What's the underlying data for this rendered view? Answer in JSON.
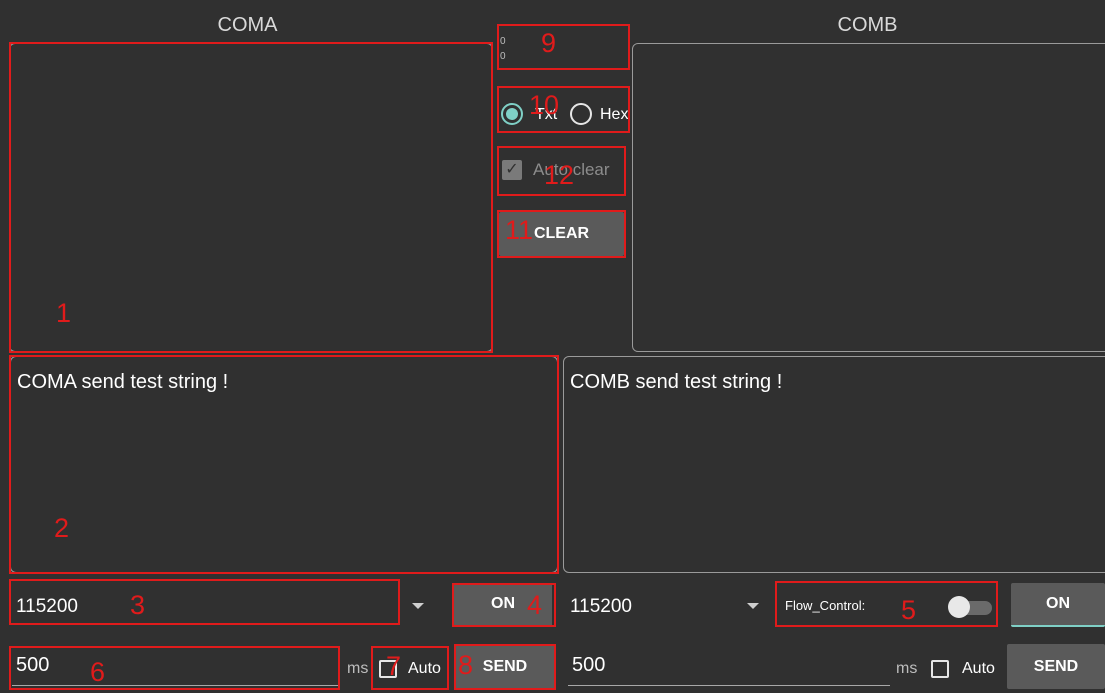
{
  "coma": {
    "title": "COMA",
    "send_text": "COMA send test string !",
    "baud": "115200",
    "on_label": "ON",
    "interval": "500",
    "ms_label": "ms",
    "auto_label": "Auto",
    "send_label": "SEND"
  },
  "comb": {
    "title": "COMB",
    "send_text": "COMB send test string !",
    "baud": "115200",
    "flow_control_label": "Flow_Control:",
    "on_label": "ON",
    "interval": "500",
    "ms_label": "ms",
    "auto_label": "Auto",
    "send_label": "SEND"
  },
  "middle": {
    "counter_rx": "0",
    "counter_tx": "0",
    "radio_txt": "Txt",
    "radio_hex": "Hex",
    "radio_selected": "Txt",
    "autoclear_label": "Auto clear",
    "autoclear_checked": true,
    "clear_label": "CLEAR"
  },
  "annotations": [
    "1",
    "2",
    "3",
    "4",
    "5",
    "6",
    "7",
    "8",
    "9",
    "10",
    "11",
    "12"
  ],
  "colors": {
    "background": "#303030",
    "accent": "#7fd0c6",
    "annotation": "#e01b1b",
    "button": "#5a5a5a"
  }
}
